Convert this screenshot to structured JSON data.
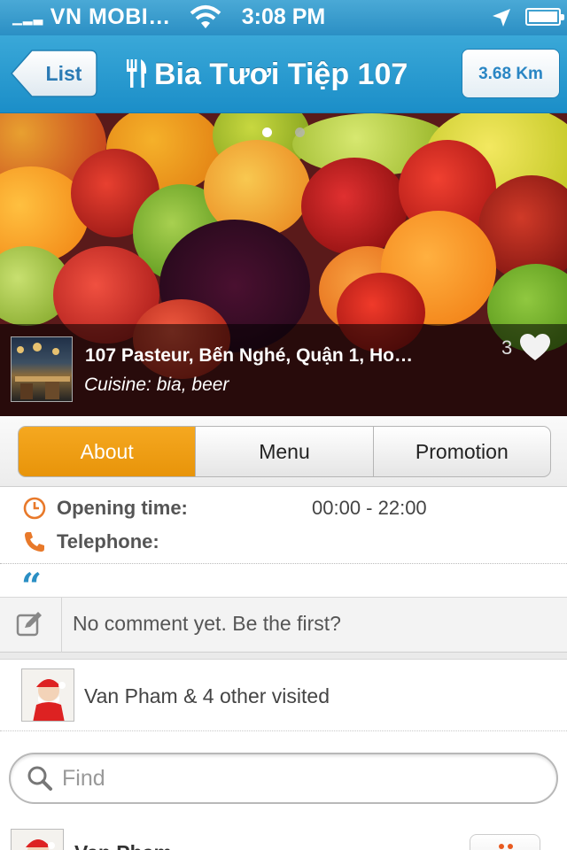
{
  "status_bar": {
    "carrier": "VN MOBI…",
    "time": "3:08 PM"
  },
  "nav": {
    "back_label": "List",
    "title": "Bia Tươi Tiệp 107",
    "distance": "3.68 Km"
  },
  "hero": {
    "page_count": 2,
    "active_page": 1,
    "address": "107 Pasteur, Bến Nghé, Quận 1, Ho…",
    "cuisine": "Cuisine: bia, beer",
    "like_count": "3"
  },
  "tabs": [
    {
      "label": "About",
      "active": true
    },
    {
      "label": "Menu",
      "active": false
    },
    {
      "label": "Promotion",
      "active": false
    }
  ],
  "details": {
    "opening_label": "Opening time:",
    "opening_value": "00:00 - 22:00",
    "phone_label": "Telephone:",
    "phone_value": ""
  },
  "comment": {
    "quote_mark": "“",
    "prompt": "No comment yet. Be the first?"
  },
  "visited": {
    "text": "Van Pham & 4 other visited"
  },
  "search": {
    "placeholder": "Find"
  },
  "list": {
    "first_item_name": "Van Pham"
  },
  "colors": {
    "nav_blue": "#1b8ec8",
    "accent_orange": "#e8940a",
    "icon_orange": "#e8792a"
  }
}
